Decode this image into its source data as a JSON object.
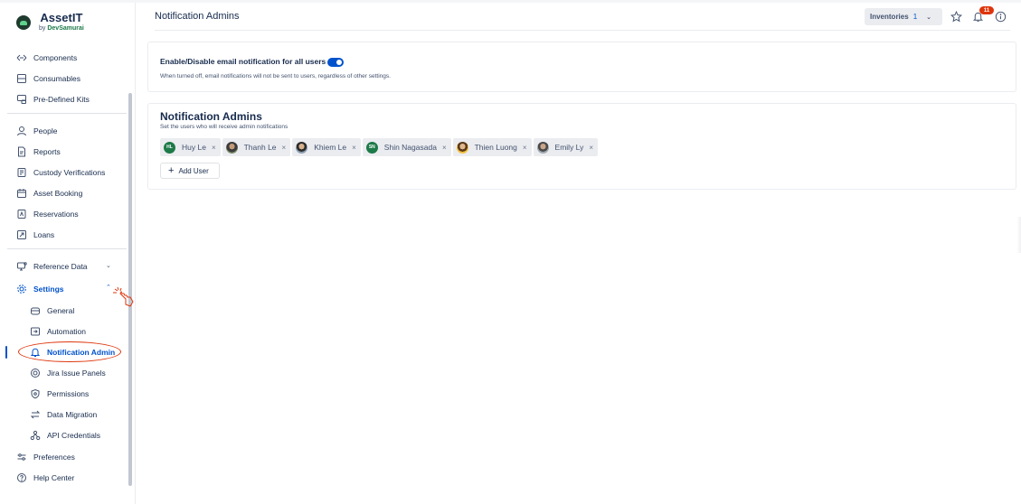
{
  "brand": {
    "title": "AssetIT",
    "sub_prefix": "by",
    "sub_brand": "DevSamurai"
  },
  "sidebar": {
    "items": [
      {
        "label": "Components",
        "icon": "components-icon"
      },
      {
        "label": "Consumables",
        "icon": "consumables-icon"
      },
      {
        "label": "Pre-Defined Kits",
        "icon": "kits-icon"
      },
      {
        "label": "People",
        "icon": "person-icon"
      },
      {
        "label": "Reports",
        "icon": "report-icon"
      },
      {
        "label": "Custody Verifications",
        "icon": "custody-icon"
      },
      {
        "label": "Asset Booking",
        "icon": "calendar-icon"
      },
      {
        "label": "Reservations",
        "icon": "reservation-icon"
      },
      {
        "label": "Loans",
        "icon": "loan-icon"
      },
      {
        "label": "Reference Data",
        "icon": "reference-data-icon"
      },
      {
        "label": "Settings",
        "icon": "gear-icon"
      }
    ],
    "settings_children": [
      {
        "label": "General",
        "icon": "general-icon"
      },
      {
        "label": "Automation",
        "icon": "automation-icon"
      },
      {
        "label": "Notification Admin",
        "icon": "bell-icon",
        "active": true
      },
      {
        "label": "Jira Issue Panels",
        "icon": "jira-panel-icon"
      },
      {
        "label": "Permissions",
        "icon": "shield-icon"
      },
      {
        "label": "Data Migration",
        "icon": "migration-icon"
      },
      {
        "label": "API Credentials",
        "icon": "api-icon"
      }
    ],
    "footer_items": [
      {
        "label": "Preferences",
        "icon": "preferences-icon"
      },
      {
        "label": "Help Center",
        "icon": "help-icon"
      }
    ]
  },
  "header": {
    "title": "Notification Admins",
    "inventories_label": "Inventories",
    "inventories_count": "1",
    "notification_count": "11"
  },
  "email_card": {
    "toggle_label": "Enable/Disable email notification for all users",
    "toggle_on": true,
    "description": "When turned off, email notifications will not be sent to users, regardless of other settings."
  },
  "admins_card": {
    "title": "Notification Admins",
    "subtitle": "Set the users who will receive admin notifications",
    "users": [
      {
        "name": "Huy Le",
        "initials": "HL"
      },
      {
        "name": "Thanh Le",
        "initials": ""
      },
      {
        "name": "Khiem Le",
        "initials": ""
      },
      {
        "name": "Shin Nagasada",
        "initials": "SN"
      },
      {
        "name": "Thien Luong",
        "initials": ""
      },
      {
        "name": "Emily Ly",
        "initials": ""
      }
    ],
    "remove_glyph": "×",
    "add_button": "Add User",
    "add_glyph": "+"
  },
  "colors": {
    "accent": "#0052cc",
    "badge": "#de350b",
    "brand_green": "#1d7a49"
  }
}
